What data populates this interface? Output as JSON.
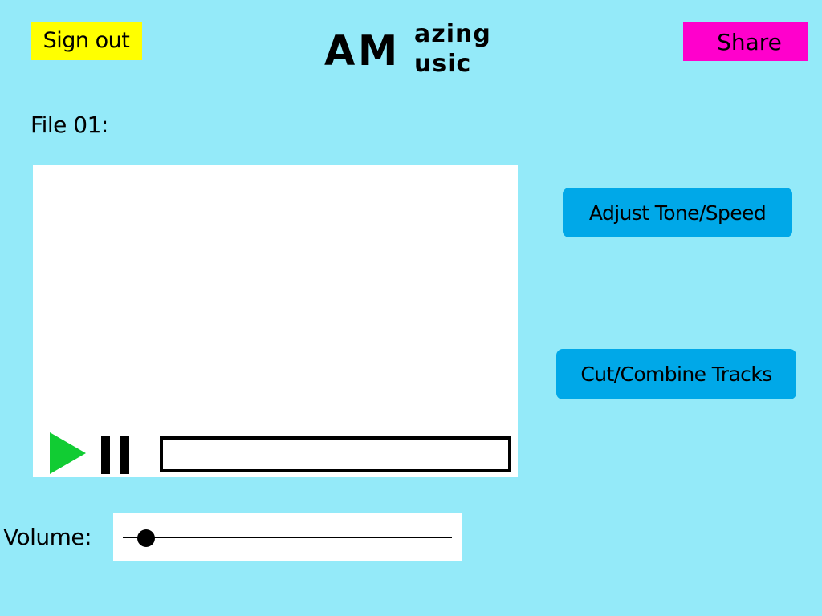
{
  "header": {
    "sign_out_label": "Sign out",
    "share_label": "Share",
    "logo": {
      "big": "AM",
      "line1": "azing",
      "line2": "usic"
    }
  },
  "file": {
    "label": "File 01:"
  },
  "player": {
    "play_icon": "play-icon",
    "pause_icon": "pause-icon",
    "progress_fraction": 0.0,
    "play_color": "#11CC33"
  },
  "actions": {
    "adjust_label": "Adjust Tone/Speed",
    "cut_label": "Cut/Combine Tracks"
  },
  "volume": {
    "label": "Volume:",
    "level_fraction": 0.07
  },
  "colors": {
    "background": "#94EAF9",
    "sign_out": "#FFFF00",
    "share": "#FF00CC",
    "action": "#00A8E8"
  }
}
